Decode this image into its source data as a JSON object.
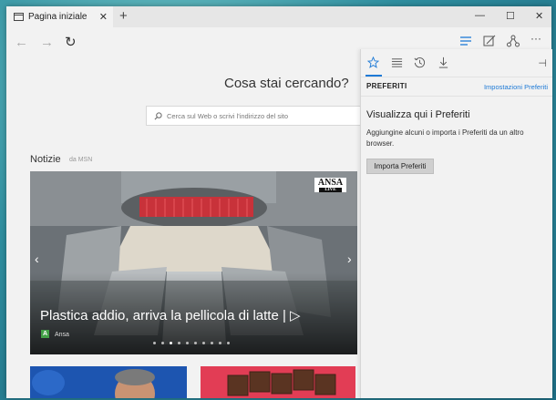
{
  "tab": {
    "title": "Pagina iniziale",
    "close_glyph": "✕"
  },
  "tabbar": {
    "new_tab_glyph": "+"
  },
  "window_controls": {
    "minimize": "—",
    "maximize": "☐",
    "close": "✕"
  },
  "nav": {
    "back": "←",
    "forward": "→",
    "refresh": "↻"
  },
  "toolbar": {
    "more": "···"
  },
  "search": {
    "title": "Cosa stai cercando?",
    "placeholder": "Cerca sul Web o scrivi l'indirizzo del sito"
  },
  "news": {
    "heading": "Notizie",
    "source": "da MSN",
    "hero": {
      "title": "Plastica addio, arriva la pellicola di latte",
      "play_glyph": "| ▷",
      "publisher_badge": "A",
      "publisher": "Ansa",
      "logo_text": "ANSA",
      "logo_sub": "LIVE",
      "prev": "‹",
      "next": "›",
      "dots_total": 10,
      "dots_active_index": 2
    }
  },
  "favorites_panel": {
    "pin_glyph": "⊣",
    "header_title": "PREFERITI",
    "settings_link": "Impostazioni Preferiti",
    "title": "Visualizza qui i Preferiti",
    "description": "Aggiungine alcuni o importa i Preferiti da un altro browser.",
    "import_button": "Importa Preferiti"
  },
  "colors": {
    "accent": "#1e7ad6",
    "chrome": "#f2f2f2",
    "tab_strip": "#e6e6e6",
    "desktop": "#2f8fa0"
  }
}
